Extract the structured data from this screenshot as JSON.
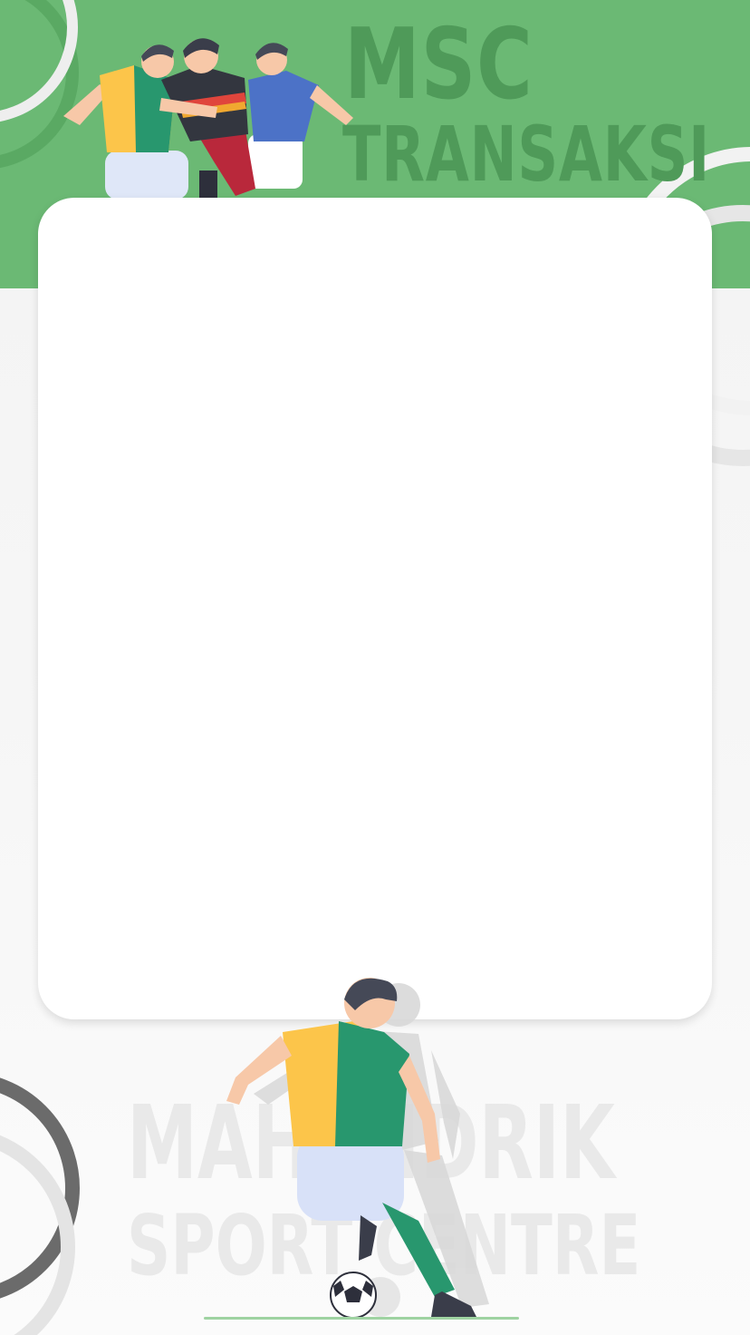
{
  "header": {
    "title_line1": "MSC",
    "title_line2": "TRANSAKSI",
    "background_color": "#6bb974",
    "title_color": "#4f9a59"
  },
  "card": {
    "background_color": "#ffffff"
  },
  "footer": {
    "watermark_line1": "MAHENDRIK",
    "watermark_line2": "SPORT CENTRE",
    "watermark_color": "#e9e9e9"
  },
  "illustrations": {
    "header": "football-players-group-icon",
    "footer": "footballer-kicking-ball-icon"
  }
}
